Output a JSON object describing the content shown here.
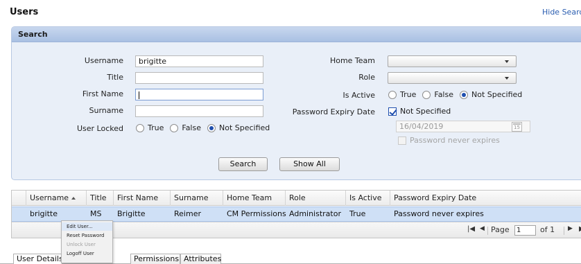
{
  "page": {
    "title": "Users",
    "hide_search_link": "Hide Search"
  },
  "search": {
    "header": "Search",
    "username_label": "Username",
    "username_value": "brigitte",
    "title_label": "Title",
    "title_value": "",
    "first_name_label": "First Name",
    "first_name_value": "",
    "surname_label": "Surname",
    "surname_value": "",
    "user_locked_label": "User Locked",
    "user_locked_options": [
      "True",
      "False",
      "Not Specified"
    ],
    "user_locked_selected": "Not Specified",
    "home_team_label": "Home Team",
    "home_team_value": "",
    "role_label": "Role",
    "role_value": "",
    "is_active_label": "Is Active",
    "is_active_options": [
      "True",
      "False",
      "Not Specified"
    ],
    "is_active_selected": "Not Specified",
    "password_expiry_label": "Password Expiry Date",
    "password_expiry_not_specified_label": "Not Specified",
    "password_expiry_not_specified_checked": true,
    "password_expiry_date": "16/04/2019",
    "calendar_icon_text": "15",
    "password_never_expires_label": "Password never expires",
    "password_never_expires_checked": false,
    "search_button": "Search",
    "show_all_button": "Show All"
  },
  "grid": {
    "columns": [
      "Username",
      "Title",
      "First Name",
      "Surname",
      "Home Team",
      "Role",
      "Is Active",
      "Password Expiry Date"
    ],
    "sorted_column": "Username",
    "sort_direction": "ascending",
    "rows": [
      [
        "brigitte",
        "MS",
        "Brigitte",
        "Reimer",
        "CM Permissions",
        "Administrator",
        "True",
        "Password never expires"
      ]
    ],
    "pager": {
      "page_label": "Page",
      "page_value": "1",
      "of_label": "of 1"
    }
  },
  "context_menu": {
    "items": [
      {
        "label": "Edit User...",
        "enabled": true
      },
      {
        "label": "Reset Password",
        "enabled": true
      },
      {
        "label": "Unlock User",
        "enabled": false
      },
      {
        "label": "Logoff User",
        "enabled": true
      }
    ]
  },
  "tabs": [
    "User Details",
    "Permissions",
    "Attributes"
  ],
  "active_tab": "User Details",
  "colors": {
    "accent": "#1f4fae",
    "panel_bg": "#e9eff8",
    "panel_header": "#b5c9e8",
    "selected_row": "#cfe0f6",
    "link": "#2a5db0"
  }
}
